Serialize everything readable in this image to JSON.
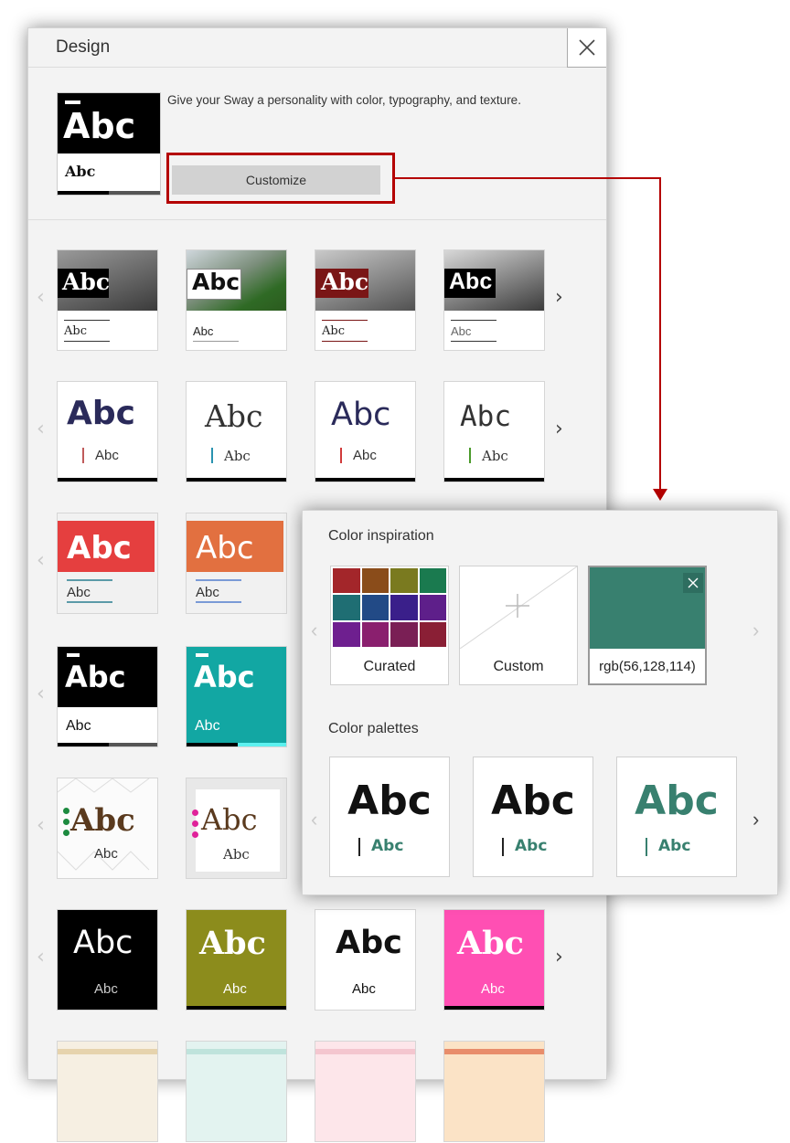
{
  "pane": {
    "title": "Design",
    "description": "Give your Sway a personality with color, typography, and texture.",
    "customize_label": "Customize",
    "current_theme": {
      "big": "Abc",
      "small": "Abc"
    }
  },
  "theme_rows": [
    {
      "cards": [
        {
          "big": "Abc",
          "small": "Abc"
        },
        {
          "big": "Abc",
          "small": "Abc"
        },
        {
          "big": "Abc",
          "small": "Abc"
        },
        {
          "big": "Abc",
          "small": "Abc"
        }
      ]
    },
    {
      "cards": [
        {
          "big": "Abc",
          "small": "Abc"
        },
        {
          "big": "Abc",
          "small": "Abc"
        },
        {
          "big": "Abc",
          "small": "Abc"
        },
        {
          "big": "Abc",
          "small": "Abc"
        }
      ]
    },
    {
      "cards": [
        {
          "big": "Abc",
          "small": "Abc"
        },
        {
          "big": "Abc",
          "small": "Abc"
        }
      ]
    },
    {
      "cards": [
        {
          "big": "Abc",
          "small": "Abc"
        },
        {
          "big": "Abc",
          "small": "Abc"
        }
      ]
    },
    {
      "cards": [
        {
          "big": "Abc",
          "small": "Abc"
        },
        {
          "big": "Abc",
          "small": "Abc"
        }
      ]
    },
    {
      "cards": [
        {
          "big": "Abc",
          "small": "Abc"
        },
        {
          "big": "Abc",
          "small": "Abc"
        },
        {
          "big": "Abc",
          "small": "Abc"
        },
        {
          "big": "Abc",
          "small": "Abc"
        }
      ]
    }
  ],
  "popup": {
    "color_inspiration_heading": "Color inspiration",
    "curated_label": "Curated",
    "custom_label": "Custom",
    "selected_color_label": "rgb(56,128,114)",
    "selected_color": "#38806f",
    "curated_swatches": [
      "#a3262a",
      "#8a4c1a",
      "#7a7a1f",
      "#1a7a4f",
      "#1f6e73",
      "#224a86",
      "#3a1f8a",
      "#5e1f8a",
      "#6e1f8f",
      "#8a1f6e",
      "#7a1f55",
      "#8a1f35"
    ],
    "color_palettes_heading": "Color palettes",
    "palettes": [
      {
        "big": "Abc",
        "small": "Abc",
        "big_color": "#111111",
        "small_color": "#38806f"
      },
      {
        "big": "Abc",
        "small": "Abc",
        "big_color": "#111111",
        "small_color": "#38806f"
      },
      {
        "big": "Abc",
        "small": "Abc",
        "big_color": "#38806f",
        "small_color": "#38806f"
      }
    ]
  }
}
